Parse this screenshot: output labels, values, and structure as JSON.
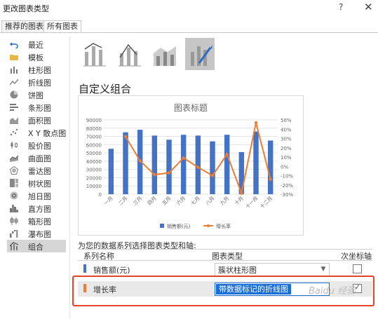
{
  "window": {
    "title": "更改图表类型",
    "help_label": "?",
    "close_label": "✕"
  },
  "tabs": [
    {
      "label": "推荐的图表",
      "active": false
    },
    {
      "label": "所有图表",
      "active": true
    }
  ],
  "sidebar": {
    "items": [
      {
        "label": "最近",
        "icon": "undo-icon"
      },
      {
        "label": "模板",
        "icon": "folder-icon"
      },
      {
        "label": "柱形图",
        "icon": "column-chart-icon"
      },
      {
        "label": "折线图",
        "icon": "line-chart-icon"
      },
      {
        "label": "饼图",
        "icon": "pie-chart-icon"
      },
      {
        "label": "条形图",
        "icon": "bar-chart-icon"
      },
      {
        "label": "面积图",
        "icon": "area-chart-icon"
      },
      {
        "label": "X Y 散点图",
        "icon": "scatter-chart-icon"
      },
      {
        "label": "股价图",
        "icon": "stock-chart-icon"
      },
      {
        "label": "曲面图",
        "icon": "surface-chart-icon"
      },
      {
        "label": "雷达图",
        "icon": "radar-chart-icon"
      },
      {
        "label": "树状图",
        "icon": "treemap-chart-icon"
      },
      {
        "label": "旭日图",
        "icon": "sunburst-chart-icon"
      },
      {
        "label": "直方图",
        "icon": "histogram-chart-icon"
      },
      {
        "label": "箱形图",
        "icon": "box-whisker-chart-icon"
      },
      {
        "label": "瀑布图",
        "icon": "waterfall-chart-icon"
      },
      {
        "label": "组合",
        "icon": "combo-chart-icon",
        "selected": true
      }
    ]
  },
  "combo_types": [
    {
      "icon": "combo-column-line-icon"
    },
    {
      "icon": "combo-column-line-secondary-icon"
    },
    {
      "icon": "combo-area-column-icon"
    },
    {
      "icon": "custom-combo-icon",
      "selected": true
    }
  ],
  "section_title": "自定义组合",
  "chart_data": {
    "type": "bar",
    "title": "图表标题",
    "categories": [
      "一月",
      "二月",
      "三月",
      "四月",
      "五月",
      "六月",
      "七月",
      "八月",
      "九月",
      "十月",
      "十一月",
      "十二月"
    ],
    "series": [
      {
        "name": "销售额(元)",
        "type": "bar",
        "axis": "primary",
        "color": "#4472c4",
        "values": [
          55000,
          75000,
          78000,
          71000,
          66000,
          72000,
          71000,
          64000,
          72000,
          51000,
          76000,
          65000
        ]
      },
      {
        "name": "增长率",
        "type": "line",
        "axis": "secondary",
        "color": "#ed7d31",
        "values": [
          null,
          0.32,
          0.06,
          -0.09,
          -0.07,
          0.09,
          -0.01,
          -0.1,
          0.13,
          -0.29,
          0.47,
          -0.14
        ]
      }
    ],
    "y_ticks": [
      "0",
      "10000",
      "20000",
      "30000",
      "40000",
      "50000",
      "60000",
      "70000",
      "80000",
      "90000"
    ],
    "y2_ticks": [
      "-30%",
      "-20%",
      "-10%",
      "0%",
      "10%",
      "20%",
      "30%",
      "40%",
      "50%"
    ],
    "ylim": [
      0,
      90000
    ],
    "y2lim": [
      -0.3,
      0.5
    ],
    "legend_position": "bottom",
    "gridlines": true
  },
  "series_config": {
    "description": "为您的数据系列选择图表类型和轴:",
    "headers": {
      "name": "系列名称",
      "type": "图表类型",
      "secondary": "次坐标轴"
    },
    "rows": [
      {
        "name": "销售额(元)",
        "color": "#4472c4",
        "chart_type": "簇状柱形图",
        "secondary": false
      },
      {
        "name": "增长率",
        "color": "#ed7d31",
        "chart_type": "带数据标记的折线图",
        "secondary": true
      }
    ]
  },
  "watermark": "Baidu 经验"
}
